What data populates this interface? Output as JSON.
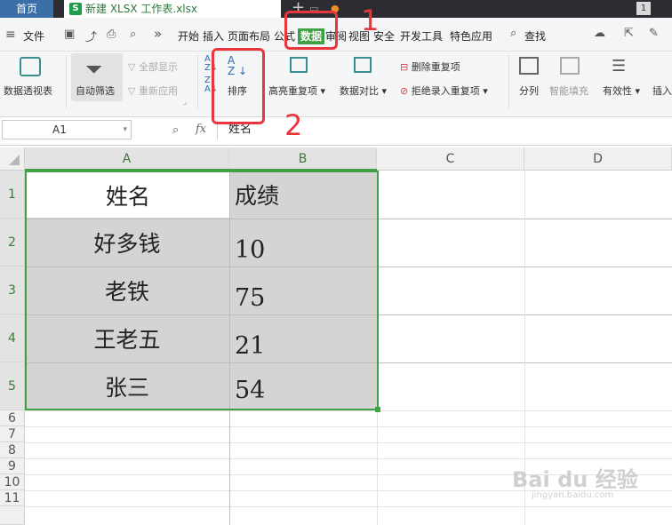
{
  "titlebar": {
    "home_tab": "首页",
    "doc_tab": "新建 XLSX 工作表.xlsx",
    "doc_icon": "S",
    "new_tab": "+",
    "window_badge": "1"
  },
  "menubar": {
    "file": "文件",
    "more": "»",
    "tabs": [
      "开始",
      "插入",
      "页面布局",
      "公式",
      "数据",
      "审阅",
      "视图",
      "安全",
      "开发工具",
      "特色应用"
    ],
    "search": "查找"
  },
  "ribbon": {
    "pivot": "数据透视表",
    "autofilter": "自动筛选",
    "show_all": "全部显示",
    "reapply": "重新应用",
    "sort": "排序",
    "highlight_dup": "高亮重复项",
    "compare": "数据对比",
    "remove_dup": "删除重复项",
    "reject_dup": "拒绝录入重复项",
    "split": "分列",
    "smart_fill": "智能填充",
    "validity": "有效性",
    "insert": "插入"
  },
  "formula_bar": {
    "name_box": "A1",
    "fx": "fx",
    "value": "姓名"
  },
  "sheet": {
    "columns": [
      "A",
      "B",
      "C",
      "D"
    ],
    "rows": [
      "1",
      "2",
      "3",
      "4",
      "5",
      "6",
      "7",
      "8",
      "9",
      "10",
      "11"
    ],
    "data": [
      [
        "姓名",
        "成绩"
      ],
      [
        "好多钱",
        "10"
      ],
      [
        "老铁",
        "75"
      ],
      [
        "王老五",
        "21"
      ],
      [
        "张三",
        "54"
      ]
    ]
  },
  "annotations": {
    "step1": "1",
    "step2": "2"
  },
  "colors": {
    "accent_green": "#3fa046",
    "annotation_red": "#e8363a",
    "selection_fill": "#d4d4d4"
  },
  "watermark": {
    "main": "Bai du 经验",
    "sub": "jingyan.baidu.com"
  }
}
